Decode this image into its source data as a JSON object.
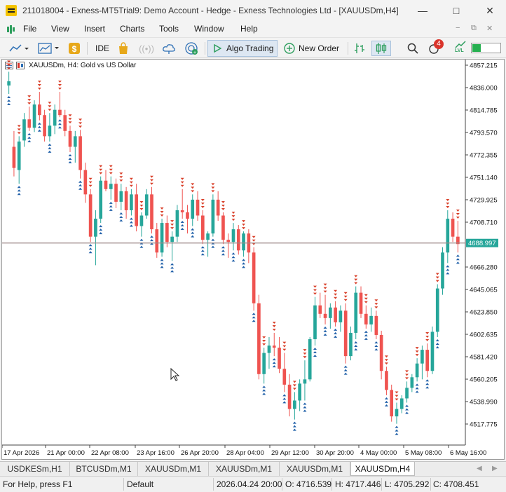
{
  "window": {
    "title": "211018004 - Exness-MT5Trial9: Demo Account - Hedge - Exness Technologies Ltd - [XAUUSDm,H4]"
  },
  "menu": {
    "items": [
      "File",
      "View",
      "Insert",
      "Charts",
      "Tools",
      "Window",
      "Help"
    ]
  },
  "toolbar": {
    "ide_label": "IDE",
    "algo_label": "Algo Trading",
    "order_label": "New Order",
    "notif_count": "4",
    "lvl_label": "LVL"
  },
  "chart": {
    "header": "XAUUSDm, H4:  Gold vs US Dollar",
    "current_price": "4688.997",
    "colors": {
      "bull": "#26a69a",
      "bear": "#ef5350",
      "bg": "#ffffff",
      "price_line": "#9e8a8a",
      "price_label_bg": "#26a69a"
    }
  },
  "chart_data": {
    "type": "candlestick",
    "title": "XAUUSDm, H4:  Gold vs US Dollar",
    "y_ticks": [
      "4857.215",
      "4836.000",
      "4814.785",
      "4793.570",
      "4772.355",
      "4751.140",
      "4729.925",
      "4708.710",
      "4688.997",
      "4666.280",
      "4645.065",
      "4623.850",
      "4602.635",
      "4581.420",
      "4560.205",
      "4538.990",
      "4517.775"
    ],
    "x_ticks": [
      "17 Apr 2026",
      "21 Apr 00:00",
      "22 Apr 08:00",
      "23 Apr 16:00",
      "26 Apr 20:00",
      "28 Apr 04:00",
      "29 Apr 12:00",
      "30 Apr 20:00",
      "4 May 00:00",
      "5 May 08:00",
      "6 May 16:00"
    ],
    "ylim": [
      4505,
      4866
    ],
    "last_price": 4688.997,
    "candles": [
      [
        4838,
        4851,
        4830,
        4842
      ],
      [
        4780,
        4795,
        4752,
        4760
      ],
      [
        4758,
        4790,
        4745,
        4785
      ],
      [
        4786,
        4812,
        4780,
        4806
      ],
      [
        4806,
        4818,
        4795,
        4798
      ],
      [
        4798,
        4824,
        4794,
        4820
      ],
      [
        4820,
        4832,
        4805,
        4810
      ],
      [
        4810,
        4815,
        4785,
        4790
      ],
      [
        4790,
        4812,
        4785,
        4800
      ],
      [
        4800,
        4820,
        4792,
        4815
      ],
      [
        4815,
        4832,
        4808,
        4810
      ],
      [
        4810,
        4815,
        4790,
        4795
      ],
      [
        4795,
        4800,
        4775,
        4780
      ],
      [
        4780,
        4795,
        4765,
        4790
      ],
      [
        4790,
        4796,
        4750,
        4758
      ],
      [
        4758,
        4765,
        4727,
        4735
      ],
      [
        4735,
        4740,
        4690,
        4695
      ],
      [
        4695,
        4720,
        4668,
        4712
      ],
      [
        4712,
        4752,
        4708,
        4748
      ],
      [
        4748,
        4758,
        4738,
        4740
      ],
      [
        4740,
        4752,
        4730,
        4745
      ],
      [
        4745,
        4750,
        4722,
        4728
      ],
      [
        4728,
        4745,
        4720,
        4738
      ],
      [
        4738,
        4742,
        4712,
        4720
      ],
      [
        4720,
        4740,
        4715,
        4735
      ],
      [
        4735,
        4745,
        4700,
        4705
      ],
      [
        4705,
        4718,
        4695,
        4715
      ],
      [
        4715,
        4740,
        4712,
        4735
      ],
      [
        4735,
        4742,
        4698,
        4702
      ],
      [
        4702,
        4708,
        4675,
        4680
      ],
      [
        4680,
        4712,
        4676,
        4708
      ],
      [
        4708,
        4715,
        4685,
        4690
      ],
      [
        4690,
        4700,
        4672,
        4695
      ],
      [
        4695,
        4725,
        4690,
        4720
      ],
      [
        4720,
        4740,
        4712,
        4718
      ],
      [
        4718,
        4725,
        4698,
        4712
      ],
      [
        4712,
        4735,
        4705,
        4730
      ],
      [
        4730,
        4738,
        4710,
        4715
      ],
      [
        4715,
        4720,
        4688,
        4692
      ],
      [
        4692,
        4700,
        4676,
        4698
      ],
      [
        4698,
        4735,
        4695,
        4730
      ],
      [
        4730,
        4738,
        4710,
        4715
      ],
      [
        4715,
        4718,
        4688,
        4692
      ],
      [
        4692,
        4698,
        4675,
        4690
      ],
      [
        4690,
        4708,
        4682,
        4702
      ],
      [
        4702,
        4706,
        4678,
        4682
      ],
      [
        4682,
        4700,
        4676,
        4698
      ],
      [
        4698,
        4702,
        4670,
        4680
      ],
      [
        4680,
        4685,
        4625,
        4632
      ],
      [
        4632,
        4640,
        4560,
        4565
      ],
      [
        4565,
        4590,
        4556,
        4585
      ],
      [
        4585,
        4600,
        4570,
        4592
      ],
      [
        4592,
        4604,
        4582,
        4590
      ],
      [
        4590,
        4600,
        4566,
        4570
      ],
      [
        4570,
        4585,
        4548,
        4555
      ],
      [
        4555,
        4565,
        4525,
        4532
      ],
      [
        4532,
        4548,
        4522,
        4540
      ],
      [
        4540,
        4560,
        4530,
        4556
      ],
      [
        4556,
        4578,
        4540,
        4560
      ],
      [
        4560,
        4600,
        4558,
        4598
      ],
      [
        4598,
        4638,
        4592,
        4630
      ],
      [
        4630,
        4642,
        4618,
        4622
      ],
      [
        4622,
        4640,
        4612,
        4618
      ],
      [
        4618,
        4632,
        4608,
        4628
      ],
      [
        4628,
        4634,
        4610,
        4614
      ],
      [
        4614,
        4630,
        4605,
        4625
      ],
      [
        4625,
        4632,
        4575,
        4582
      ],
      [
        4582,
        4610,
        4578,
        4604
      ],
      [
        4604,
        4648,
        4598,
        4642
      ],
      [
        4642,
        4648,
        4618,
        4622
      ],
      [
        4622,
        4630,
        4608,
        4612
      ],
      [
        4612,
        4628,
        4605,
        4620
      ],
      [
        4620,
        4625,
        4598,
        4602
      ],
      [
        4602,
        4606,
        4560,
        4568
      ],
      [
        4568,
        4572,
        4545,
        4550
      ],
      [
        4550,
        4555,
        4520,
        4525
      ],
      [
        4525,
        4538,
        4518,
        4532
      ],
      [
        4532,
        4545,
        4528,
        4542
      ],
      [
        4542,
        4558,
        4538,
        4552
      ],
      [
        4552,
        4565,
        4548,
        4562
      ],
      [
        4562,
        4580,
        4558,
        4575
      ],
      [
        4575,
        4592,
        4560,
        4588
      ],
      [
        4588,
        4594,
        4562,
        4568
      ],
      [
        4568,
        4610,
        4565,
        4605
      ],
      [
        4605,
        4650,
        4600,
        4646
      ],
      [
        4646,
        4685,
        4640,
        4680
      ],
      [
        4680,
        4720,
        4670,
        4712
      ],
      [
        4712,
        4718,
        4690,
        4695
      ],
      [
        4695,
        4710,
        4680,
        4688
      ]
    ]
  },
  "tabs": [
    "USDKESm,H1",
    "BTCUSDm,M1",
    "XAUUSDm,M1",
    "XAUUSDm,M1",
    "XAUUSDm,M1",
    "XAUUSDm,H4"
  ],
  "status": {
    "help": "For Help, press F1",
    "profile": "Default",
    "datetime": "2026.04.24 20:00",
    "open": "O: 4716.539",
    "high": "H: 4717.446",
    "low": "L: 4705.292",
    "close": "C: 4708.451"
  }
}
